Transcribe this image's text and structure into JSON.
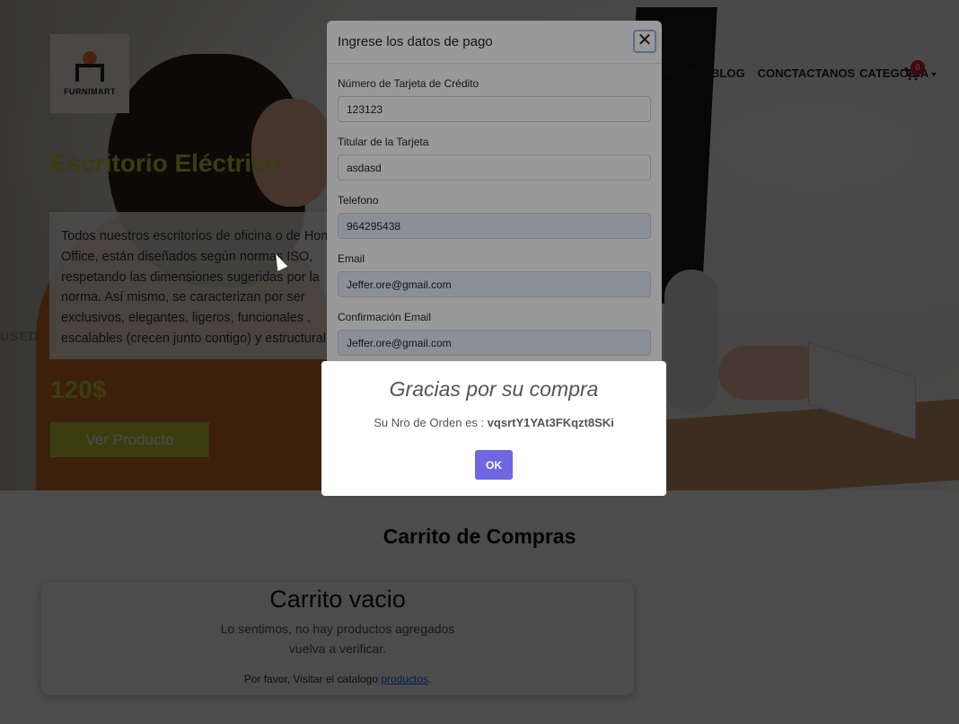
{
  "brand": {
    "logo_text": "FURNIMART"
  },
  "nav": {
    "items": [
      "NOSOTROS",
      "BLOG",
      "CONCTACTANOS",
      "CATEGORIA"
    ],
    "cart_count": "0"
  },
  "hero": {
    "title": "Escritorio Eléctrico",
    "description": "Todos nuestros escritorios de oficina o de Home Office, están diseñados según normas ISO, respetando las dimensiones sugeridas por la norma. Así mismo, se caracterizan por ser exclusivos, elegantes, ligeros, funcionales , escalables (crecen junto contigo) y estructural.",
    "price": "120$",
    "button_label": "Ver Producto",
    "background_sign": "USED."
  },
  "cart": {
    "heading": "Carrito de Compras",
    "empty_title": "Carrito vacio",
    "empty_line1": "Lo sentimos, no hay productos agregados",
    "empty_line2": "vuelva a verificar.",
    "note_prefix": "Por favor, Visitar el catalogo ",
    "note_link": "productos",
    "note_suffix": "."
  },
  "payment_modal": {
    "title": "Ingrese los datos de pago",
    "close_icon": "close-icon",
    "fields": [
      {
        "label": "Número de Tarjeta de Crédito",
        "value": "123123"
      },
      {
        "label": "Titular de la Tarjeta",
        "value": "asdasd"
      },
      {
        "label": "Telefono",
        "value": "964295438"
      },
      {
        "label": "Email",
        "value": "Jeffer.ore@gmail.com"
      },
      {
        "label": "Confirmación Email",
        "value": "Jeffer.ore@gmail.com"
      }
    ]
  },
  "success_alert": {
    "title": "Gracias por su compra",
    "message_prefix": "Su Nro de Orden es : ",
    "order_number": "vqsrtY1YAt3FKqzt8SKi",
    "ok_label": "OK"
  },
  "colors": {
    "accent": "#c5cc37",
    "confirm_button": "#7066e0",
    "badge": "#d21f2d",
    "link": "#0d6efd"
  }
}
